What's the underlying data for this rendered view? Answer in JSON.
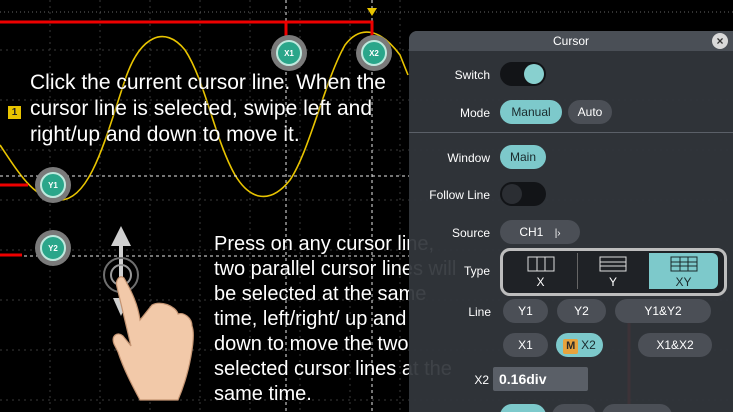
{
  "captions": {
    "select_instruction": "Click the current cursor line. When the cursor line is selected, swipe left and right/up and down to move it.",
    "pair_instruction": "Press on any cursor line, two parallel cursor lines will be selected at the same time, left/right/ up and down to move the two selected cursor lines at the same time."
  },
  "scope": {
    "channel_flag": "1",
    "markers": {
      "x1": "X1",
      "x2": "X2",
      "y1": "Y1",
      "y2": "Y2"
    }
  },
  "panel": {
    "title": "Cursor",
    "close": "×",
    "switch_label": "Switch",
    "mode_label": "Mode",
    "mode_options": [
      "Manual",
      "Auto"
    ],
    "mode_selected": "Manual",
    "window_label": "Window",
    "window_value": "Main",
    "follow_label": "Follow Line",
    "source_label": "Source",
    "source_value": "CH1",
    "source_arrow": "|›",
    "type_label": "Type",
    "type_options": [
      "X",
      "Y",
      "XY"
    ],
    "type_selected": "XY",
    "line_label": "Line",
    "line_row1": [
      "Y1",
      "Y2",
      "Y1&Y2"
    ],
    "line_row2_x1": "X1",
    "line_row2_m": "M",
    "line_row2_x2": "X2",
    "line_row2_pair": "X1&X2",
    "x2_label": "X2",
    "x2_value": "0.16div"
  },
  "colors": {
    "accent": "#7dc9cb",
    "trace": "#e8c400",
    "annotation": "#e00000",
    "marker": "#2aa68a",
    "panel_bg": "#32363c"
  }
}
